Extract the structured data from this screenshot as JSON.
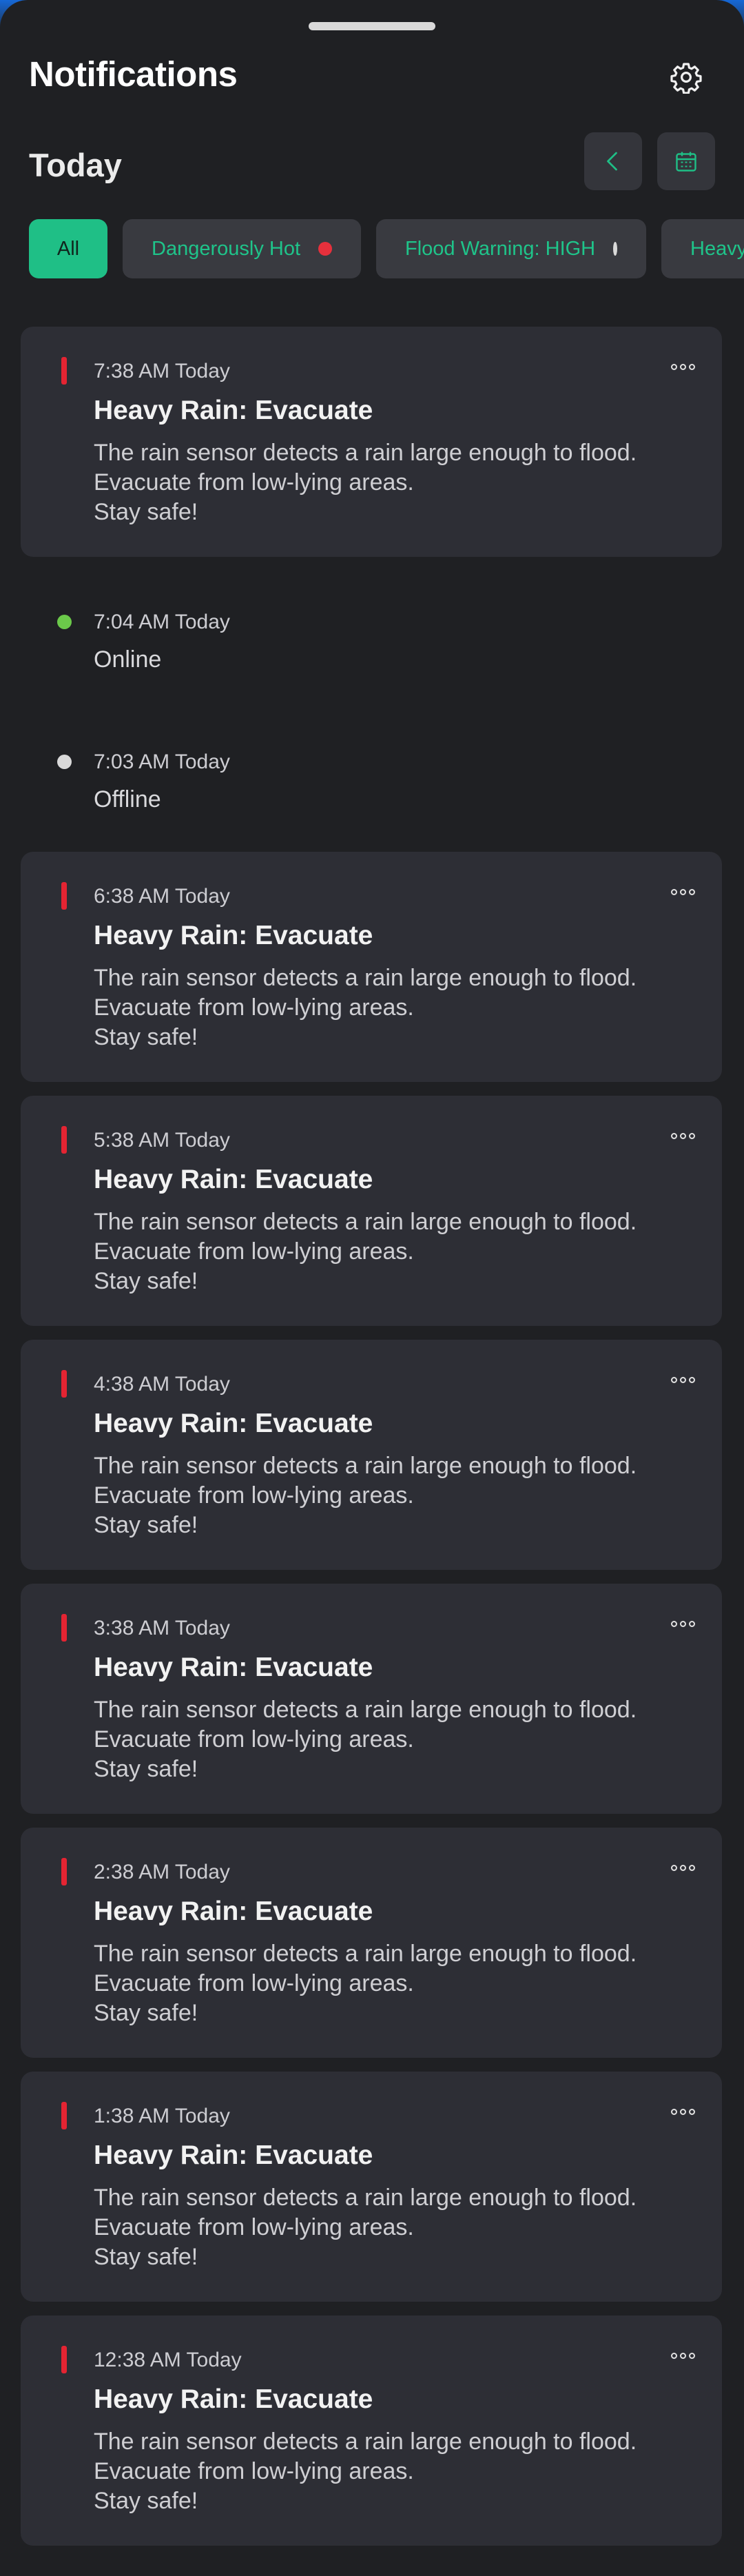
{
  "header": {
    "title": "Notifications",
    "settings_icon": "gear-icon"
  },
  "section": {
    "title": "Today",
    "back_icon": "chevron-left-icon",
    "calendar_icon": "calendar-icon"
  },
  "filters": [
    {
      "label": "All",
      "active": true
    },
    {
      "label": "Dangerously Hot",
      "dot": "#e6303c"
    },
    {
      "label": "Flood Warning: HIGH",
      "dot": "#d9d9d9"
    },
    {
      "label": "Heavy"
    }
  ],
  "alerts": [
    {
      "time": "7:38 AM Today",
      "title": "Heavy Rain: Evacuate",
      "line1": "The rain sensor detects a rain large enough to flood.",
      "line2": "Evacuate from low-lying areas.",
      "line3": "Stay safe!"
    },
    {
      "time": "6:38 AM Today",
      "title": "Heavy Rain: Evacuate",
      "line1": "The rain sensor detects a rain large enough to flood.",
      "line2": "Evacuate from low-lying areas.",
      "line3": "Stay safe!"
    },
    {
      "time": "5:38 AM Today",
      "title": "Heavy Rain: Evacuate",
      "line1": "The rain sensor detects a rain large enough to flood.",
      "line2": "Evacuate from low-lying areas.",
      "line3": "Stay safe!"
    },
    {
      "time": "4:38 AM Today",
      "title": "Heavy Rain: Evacuate",
      "line1": "The rain sensor detects a rain large enough to flood.",
      "line2": "Evacuate from low-lying areas.",
      "line3": "Stay safe!"
    },
    {
      "time": "3:38 AM Today",
      "title": "Heavy Rain: Evacuate",
      "line1": "The rain sensor detects a rain large enough to flood.",
      "line2": "Evacuate from low-lying areas.",
      "line3": "Stay safe!"
    },
    {
      "time": "2:38 AM Today",
      "title": "Heavy Rain: Evacuate",
      "line1": "The rain sensor detects a rain large enough to flood.",
      "line2": "Evacuate from low-lying areas.",
      "line3": "Stay safe!"
    },
    {
      "time": "1:38 AM Today",
      "title": "Heavy Rain: Evacuate",
      "line1": "The rain sensor detects a rain large enough to flood.",
      "line2": "Evacuate from low-lying areas.",
      "line3": "Stay safe!"
    },
    {
      "time": "12:38 AM Today",
      "title": "Heavy Rain: Evacuate",
      "line1": "The rain sensor detects a rain large enough to flood.",
      "line2": "Evacuate from low-lying areas.",
      "line3": "Stay safe!"
    }
  ],
  "statuses": [
    {
      "time": "7:04 AM Today",
      "label": "Online",
      "color": "#6bc94a"
    },
    {
      "time": "7:03 AM Today",
      "label": "Offline",
      "color": "#d9d9d9"
    }
  ],
  "colors": {
    "accent": "#1fbf86",
    "alert": "#e42432"
  }
}
